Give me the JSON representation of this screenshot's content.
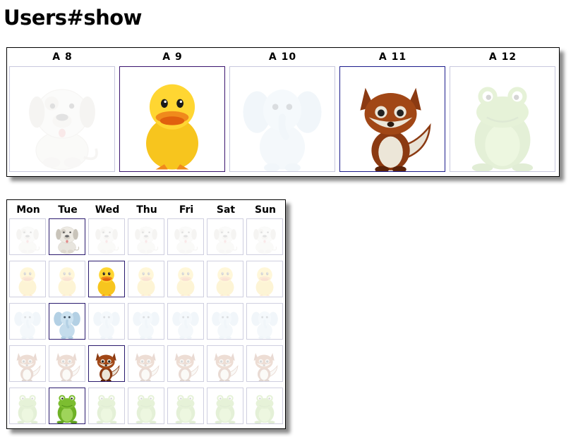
{
  "page": {
    "title": "Users#show"
  },
  "week": {
    "columns": [
      {
        "label": "A 8",
        "animal": "dog-icon",
        "active": false
      },
      {
        "label": "A 9",
        "animal": "duck-icon",
        "active": true
      },
      {
        "label": "A 10",
        "animal": "elephant-icon",
        "active": false
      },
      {
        "label": "A 11",
        "animal": "fox-icon",
        "active": true
      },
      {
        "label": "A 12",
        "animal": "frog-icon",
        "active": false
      }
    ]
  },
  "calendar": {
    "days": [
      "Mon",
      "Tue",
      "Wed",
      "Thu",
      "Fri",
      "Sat",
      "Sun"
    ],
    "rows": [
      {
        "animal": "dog-icon",
        "active_day": "Tue"
      },
      {
        "animal": "duck-icon",
        "active_day": "Wed"
      },
      {
        "animal": "elephant-icon",
        "active_day": "Tue"
      },
      {
        "animal": "fox-icon",
        "active_day": "Wed"
      },
      {
        "animal": "frog-icon",
        "active_day": "Tue"
      }
    ]
  },
  "colors": {
    "dog": "#e9e6df",
    "duck": "#f8c91c",
    "elephant": "#bcd8ea",
    "fox": "#8b3a12",
    "frog": "#7fbf2f"
  }
}
